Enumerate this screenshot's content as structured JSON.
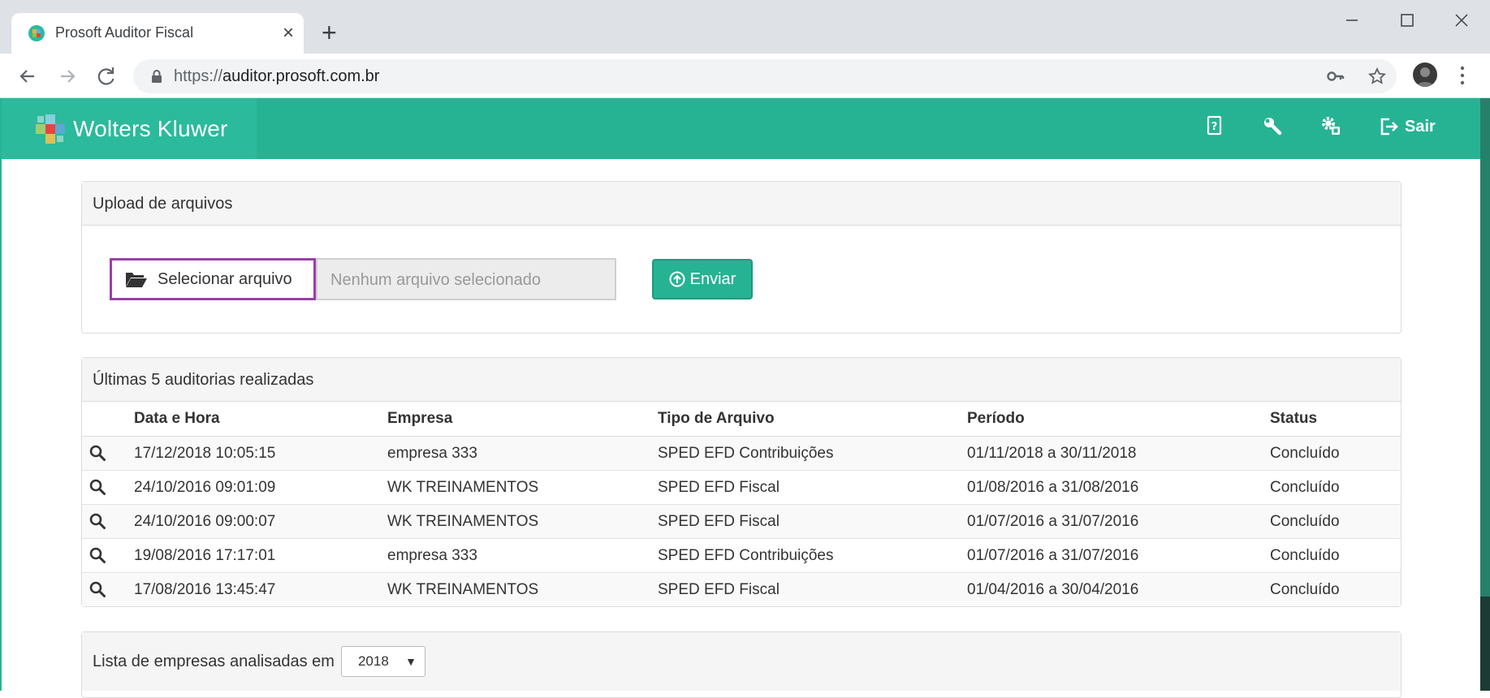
{
  "browser": {
    "tab_title": "Prosoft Auditor Fiscal",
    "tab_close": "×",
    "new_tab": "+",
    "url_scheme": "https://",
    "url_host": "auditor.prosoft.com.br"
  },
  "header": {
    "brand": "Wolters Kluwer",
    "icons": [
      "help-icon",
      "wrench-icon",
      "settings-icon"
    ],
    "exit_label": "Sair",
    "colors": {
      "accent": "#26b394"
    }
  },
  "upload": {
    "title": "Upload de arquivos",
    "select_label": "Selecionar arquivo",
    "file_placeholder": "Nenhum arquivo selecionado",
    "send_label": "Enviar"
  },
  "recent": {
    "title": "Últimas 5 auditorias realizadas",
    "columns": [
      "Data e Hora",
      "Empresa",
      "Tipo de Arquivo",
      "Período",
      "Status"
    ],
    "rows": [
      {
        "datetime": "17/12/2018 10:05:15",
        "company": "empresa 333",
        "type": "SPED EFD Contribuições",
        "period": "01/11/2018 a 30/11/2018",
        "status": "Concluído"
      },
      {
        "datetime": "24/10/2016 09:01:09",
        "company": "WK TREINAMENTOS",
        "type": "SPED EFD Fiscal",
        "period": "01/08/2016 a 31/08/2016",
        "status": "Concluído"
      },
      {
        "datetime": "24/10/2016 09:00:07",
        "company": "WK TREINAMENTOS",
        "type": "SPED EFD Fiscal",
        "period": "01/07/2016 a 31/07/2016",
        "status": "Concluído"
      },
      {
        "datetime": "19/08/2016 17:17:01",
        "company": "empresa 333",
        "type": "SPED EFD Contribuições",
        "period": "01/07/2016 a 31/07/2016",
        "status": "Concluído"
      },
      {
        "datetime": "17/08/2016 13:45:47",
        "company": "WK TREINAMENTOS",
        "type": "SPED EFD Fiscal",
        "period": "01/04/2016 a 30/04/2016",
        "status": "Concluído"
      }
    ]
  },
  "companies_list": {
    "title": "Lista de empresas analisadas em",
    "year": "2018",
    "caret": "▼"
  }
}
